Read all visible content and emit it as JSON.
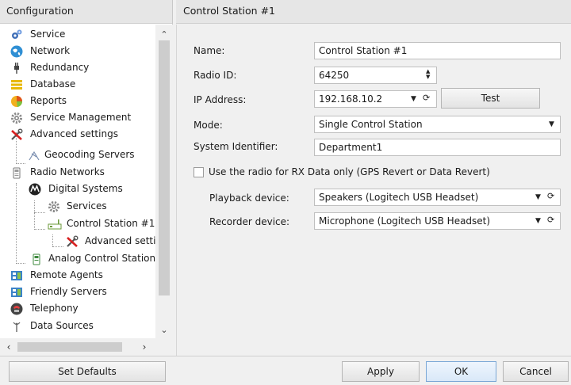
{
  "left_panel": {
    "header": "Configuration",
    "tree": [
      {
        "label": "Service",
        "icon": "gear-icon"
      },
      {
        "label": "Network",
        "icon": "globe-icon"
      },
      {
        "label": "Redundancy",
        "icon": "plug-icon"
      },
      {
        "label": "Database",
        "icon": "database-icon"
      },
      {
        "label": "Reports",
        "icon": "report-icon"
      },
      {
        "label": "Service Management",
        "icon": "cog-icon"
      },
      {
        "label": "Advanced settings",
        "icon": "tools-icon"
      },
      {
        "label": "Geocoding Servers",
        "icon": "geocoding-icon"
      },
      {
        "label": "Radio Networks",
        "icon": "radio-icon"
      },
      {
        "label": "Digital Systems",
        "icon": "motorola-icon"
      },
      {
        "label": "Services",
        "icon": "cog-icon"
      },
      {
        "label": "Control Station #1",
        "icon": "control-station-icon"
      },
      {
        "label": "Advanced setti",
        "icon": "tools-icon"
      },
      {
        "label": "Analog Control Stations",
        "icon": "radio-icon"
      },
      {
        "label": "Remote Agents",
        "icon": "agent-icon"
      },
      {
        "label": "Friendly Servers",
        "icon": "server-icon"
      },
      {
        "label": "Telephony",
        "icon": "phone-icon"
      },
      {
        "label": "Data Sources",
        "icon": "antenna-icon"
      }
    ]
  },
  "right_panel": {
    "header": "Control Station #1",
    "name_label": "Name:",
    "name_value": "Control Station #1",
    "radio_id_label": "Radio ID:",
    "radio_id_value": "64250",
    "ip_label": "IP Address:",
    "ip_value": "192.168.10.2",
    "test_button": "Test",
    "mode_label": "Mode:",
    "mode_value": "Single Control Station",
    "system_id_label": "System Identifier:",
    "system_id_value": "Department1",
    "rx_checkbox_label": "Use the radio for RX Data only (GPS Revert or Data Revert)",
    "rx_checkbox_checked": false,
    "playback_label": "Playback device:",
    "playback_value": "Speakers (Logitech USB Headset)",
    "recorder_label": "Recorder device:",
    "recorder_value": "Microphone (Logitech USB Headset)"
  },
  "bottom_bar": {
    "set_defaults": "Set Defaults",
    "apply": "Apply",
    "ok": "OK",
    "cancel": "Cancel"
  },
  "colors": {
    "panel_bg": "#f0f0f0",
    "header_bg": "#e6e6e6",
    "tree_bg": "#ffffff",
    "primary_button_border": "#7aa7d6"
  }
}
